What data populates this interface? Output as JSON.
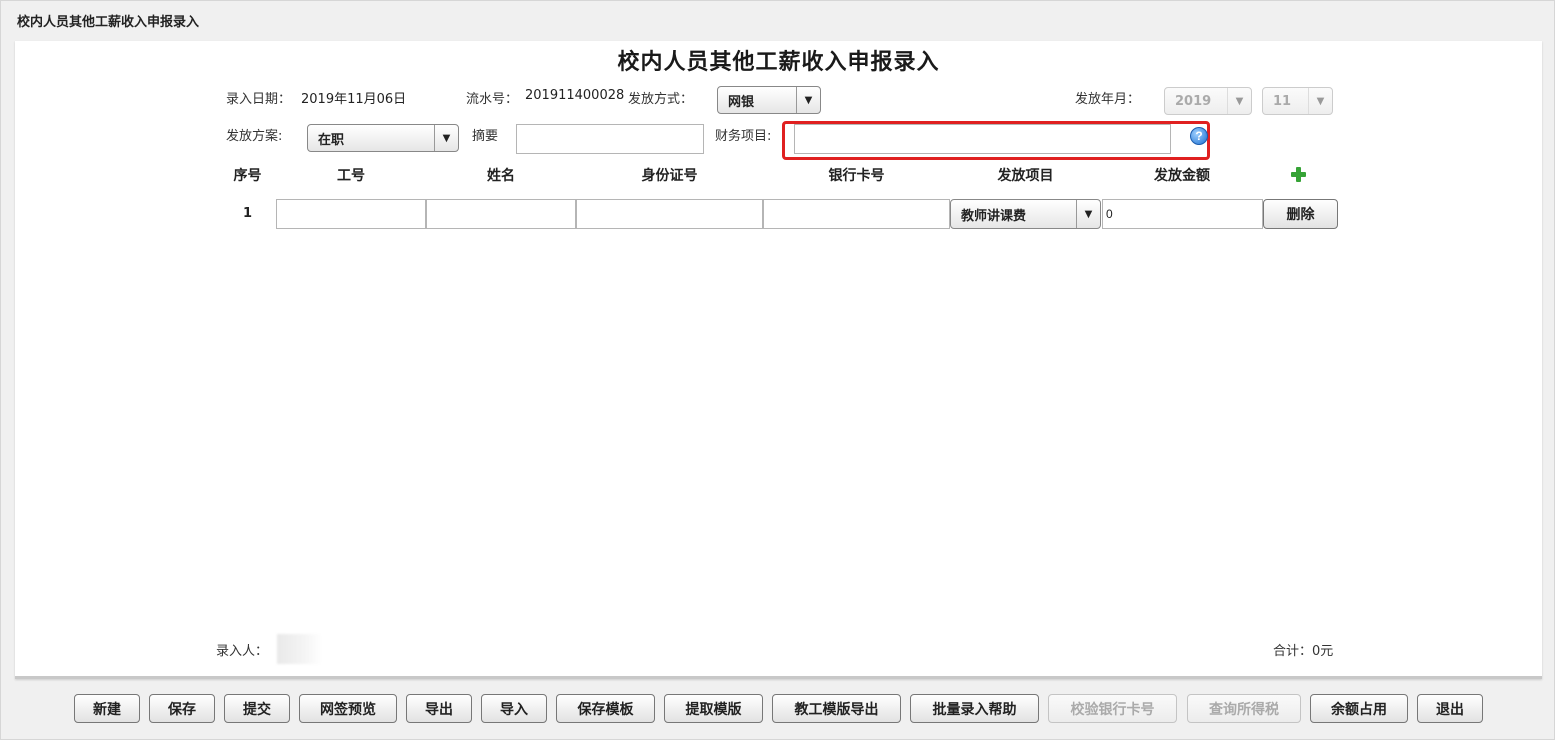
{
  "window": {
    "title": "校内人员其他工薪收入申报录入"
  },
  "form": {
    "title": "校内人员其他工薪收入申报录入",
    "entry_date_label": "录入日期：",
    "entry_date": "2019年11月06日",
    "serial_label": "流水号：",
    "serial": "201911400028",
    "pay_method_label": "发放方式：",
    "pay_method": "网银",
    "pay_month_label": "发放年月：",
    "pay_year": "2019",
    "pay_month": "11",
    "plan_label": "发放方案:",
    "plan": "在职",
    "summary_label": "摘要",
    "summary_value": "",
    "finance_label": "财务项目:",
    "finance_value": "",
    "help_glyph": "?"
  },
  "table": {
    "headers": [
      "序号",
      "工号",
      "姓名",
      "身份证号",
      "银行卡号",
      "发放项目",
      "发放金额"
    ],
    "rows": [
      {
        "no": "1",
        "emp_id": "",
        "name": "",
        "id_card": "",
        "bank_card": "",
        "item": "教师讲课费",
        "amount": "0",
        "delete_label": "删除"
      }
    ]
  },
  "footer": {
    "entered_by_label": "录入人：",
    "total": "合计：0元"
  },
  "toolbar": {
    "buttons": [
      {
        "label": "新建",
        "enabled": true
      },
      {
        "label": "保存",
        "enabled": true
      },
      {
        "label": "提交",
        "enabled": true
      },
      {
        "label": "网签预览",
        "enabled": true
      },
      {
        "label": "导出",
        "enabled": true
      },
      {
        "label": "导入",
        "enabled": true
      },
      {
        "label": "保存模板",
        "enabled": true
      },
      {
        "label": "提取模版",
        "enabled": true
      },
      {
        "label": "教工模版导出",
        "enabled": true
      },
      {
        "label": "批量录入帮助",
        "enabled": true
      },
      {
        "label": "校验银行卡号",
        "enabled": false
      },
      {
        "label": "查询所得税",
        "enabled": false
      },
      {
        "label": "余额占用",
        "enabled": true
      },
      {
        "label": "退出",
        "enabled": true
      }
    ]
  },
  "colors": {
    "highlight": "#e02020",
    "add_icon": "#36a336",
    "help_icon": "#1b6fd0"
  },
  "icons": {
    "add": "plus-icon",
    "help": "help-icon",
    "dropdown": "chevron-down-icon"
  }
}
